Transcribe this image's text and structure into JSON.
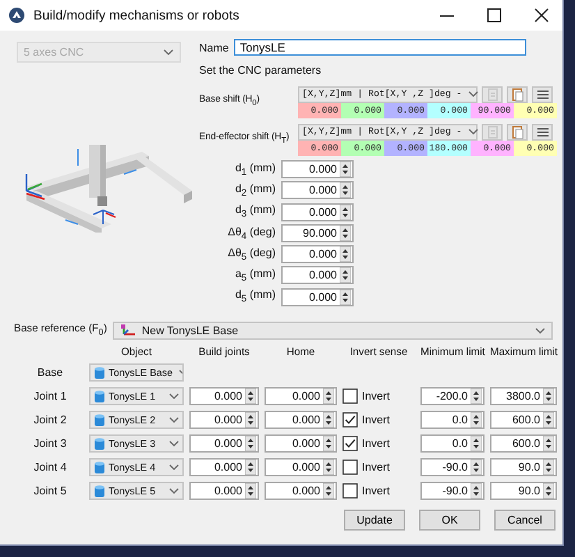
{
  "window": {
    "title": "Build/modify mechanisms or robots"
  },
  "mechanism_type": {
    "value": "5 axes CNC",
    "disabled": true
  },
  "name": {
    "label": "Name",
    "value": "TonysLE"
  },
  "instructions": "Set the CNC parameters",
  "frames": [
    {
      "label": "Base shift (H$_{0}$)",
      "format": "[X,Y,Z]mm | Rot[X,Y ,Z  ]deg -",
      "values": [
        {
          "text": "0.000",
          "color": "#ffb3b3"
        },
        {
          "text": "0.000",
          "color": "#b3ffb3"
        },
        {
          "text": "0.000",
          "color": "#b3b3ff"
        },
        {
          "text": "0.000",
          "color": "#b3ffff"
        },
        {
          "text": "90.000",
          "color": "#ffb3ff"
        },
        {
          "text": "0.000",
          "color": "#ffffb3"
        }
      ]
    },
    {
      "label": "End-effector shift (H$_{T}$)",
      "format": "[X,Y,Z]mm | Rot[X,Y ,Z  ]deg -",
      "values": [
        {
          "text": "0.000",
          "color": "#ffb3b3"
        },
        {
          "text": "0.000",
          "color": "#b3ffb3"
        },
        {
          "text": "0.000",
          "color": "#b3b3ff"
        },
        {
          "text": "180.000",
          "color": "#b3ffff"
        },
        {
          "text": "0.000",
          "color": "#ffb3ff"
        },
        {
          "text": "0.000",
          "color": "#ffffb3"
        }
      ]
    }
  ],
  "parameters": [
    {
      "label": "d$_{1}$ (mm)",
      "value": "0.000"
    },
    {
      "label": "d$_{2}$ (mm)",
      "value": "0.000"
    },
    {
      "label": "d$_{3}$ (mm)",
      "value": "0.000"
    },
    {
      "label": "Δθ$_{4}$ (deg)",
      "value": "90.000"
    },
    {
      "label": "Δθ$_{5}$ (deg)",
      "value": "0.000"
    },
    {
      "label": "a$_{5}$ (mm)",
      "value": "0.000"
    },
    {
      "label": "d$_{5}$ (mm)",
      "value": "0.000"
    }
  ],
  "base_reference": {
    "label": "Base reference (F$_{0}$)",
    "value": "New TonysLE Base"
  },
  "table": {
    "columns": [
      "Object",
      "Build joints",
      "Home",
      "Invert sense",
      "Minimum limit",
      "Maximum limit"
    ],
    "base": {
      "label": "Base",
      "object": "TonysLE Base"
    },
    "joints": [
      {
        "label": "Joint 1",
        "object": "TonysLE 1",
        "build": "0.000",
        "home": "0.000",
        "invert": {
          "label": "Invert",
          "checked": false
        },
        "min": "-200.0",
        "max": "3800.0"
      },
      {
        "label": "Joint 2",
        "object": "TonysLE 2",
        "build": "0.000",
        "home": "0.000",
        "invert": {
          "label": "Invert",
          "checked": true
        },
        "min": "0.0",
        "max": "600.0"
      },
      {
        "label": "Joint 3",
        "object": "TonysLE 3",
        "build": "0.000",
        "home": "0.000",
        "invert": {
          "label": "Invert",
          "checked": true
        },
        "min": "0.0",
        "max": "600.0"
      },
      {
        "label": "Joint 4",
        "object": "TonysLE 4",
        "build": "0.000",
        "home": "0.000",
        "invert": {
          "label": "Invert",
          "checked": false
        },
        "min": "-90.0",
        "max": "90.0"
      },
      {
        "label": "Joint 5",
        "object": "TonysLE 5",
        "build": "0.000",
        "home": "0.000",
        "invert": {
          "label": "Invert",
          "checked": false
        },
        "min": "-90.0",
        "max": "90.0"
      }
    ]
  },
  "buttons": [
    "Update",
    "OK",
    "Cancel"
  ]
}
